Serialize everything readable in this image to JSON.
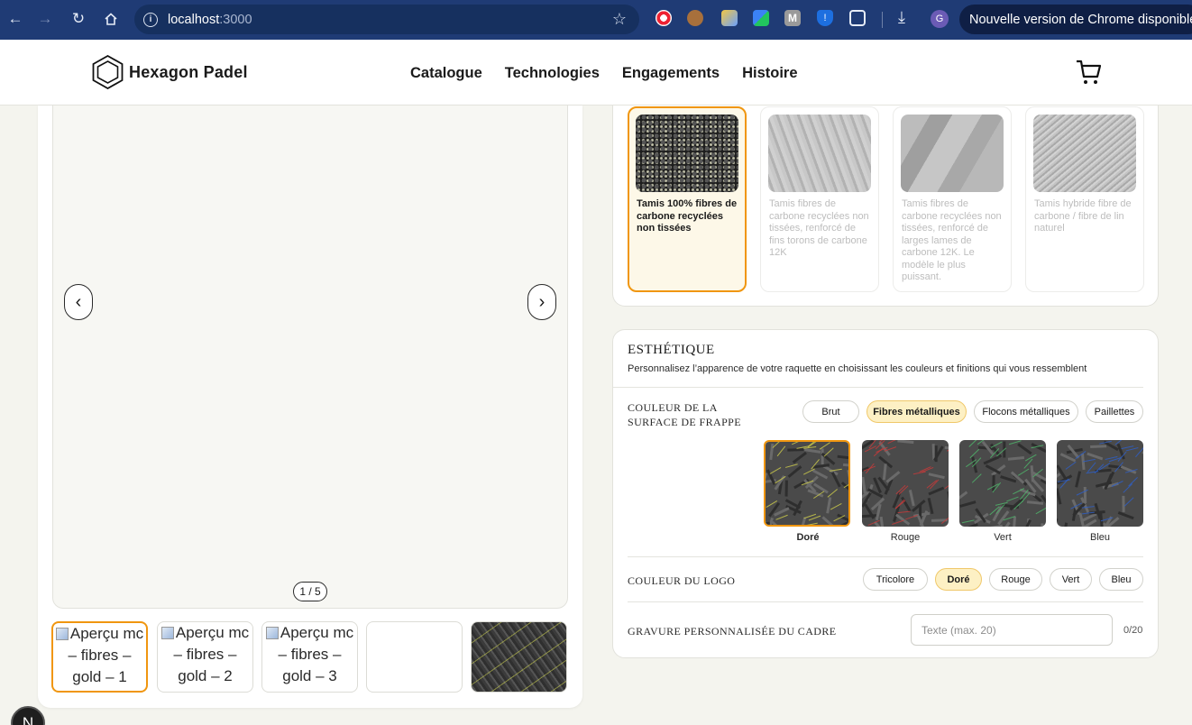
{
  "browser": {
    "url_host": "localhost",
    "url_port": ":3000",
    "update_label": "Nouvelle version de Chrome disponible",
    "profile_initial": "G",
    "ext_m_label": "M",
    "ext_shield_label": "!"
  },
  "site": {
    "brand": "Hexagon Padel",
    "nav": [
      "Catalogue",
      "Technologies",
      "Engagements",
      "Histoire"
    ]
  },
  "gallery": {
    "counter": "1 / 5",
    "prev": "‹",
    "next": "›",
    "thumbs": [
      "Aperçu mc – fibres – gold – 1",
      "Aperçu mc – fibres – gold – 2",
      "Aperçu mc – fibres – gold – 3"
    ]
  },
  "material": {
    "options": [
      {
        "label": "Tamis 100% fibres de carbone recyclées non tissées",
        "selected": true
      },
      {
        "label": "Tamis fibres de carbone recyclées non tissées, renforcé de fins torons de carbone 12K",
        "selected": false
      },
      {
        "label": "Tamis fibres de carbone recyclées non tissées, renforcé de larges lames de carbone 12K. Le modèle le plus puissant.",
        "selected": false
      },
      {
        "label": "Tamis hybride fibre de carbone / fibre de lin naturel",
        "selected": false
      }
    ]
  },
  "aesthetics": {
    "title": "ESTHÉTIQUE",
    "subtitle": "Personnalisez l’apparence de votre raquette en choisissant les couleurs et finitions qui vous ressemblent",
    "surface": {
      "label_line1": "COULEUR DE LA",
      "label_line2": "SURFACE DE FRAPPE",
      "finishes": [
        "Brut",
        "Fibres métalliques",
        "Flocons métalliques",
        "Paillettes"
      ],
      "active_finish": "Fibres métalliques",
      "colors": [
        {
          "name": "Doré",
          "color": "#c9c84a",
          "selected": true
        },
        {
          "name": "Rouge",
          "color": "#c43a3a",
          "selected": false
        },
        {
          "name": "Vert",
          "color": "#4fb36a",
          "selected": false
        },
        {
          "name": "Bleu",
          "color": "#2f5fc4",
          "selected": false
        }
      ]
    },
    "logo": {
      "label": "COULEUR DU LOGO",
      "options": [
        "Tricolore",
        "Doré",
        "Rouge",
        "Vert",
        "Bleu"
      ],
      "active": "Doré"
    },
    "engraving": {
      "label": "GRAVURE PERSONNALISÉE DU CADRE",
      "placeholder": "Texte (max. 20)",
      "count": "0/20"
    }
  },
  "colors": {
    "accent": "#f0960f",
    "chrome_bar": "#1f3b75",
    "pill_active": "#fdf0c4"
  },
  "dev_badge": "N"
}
